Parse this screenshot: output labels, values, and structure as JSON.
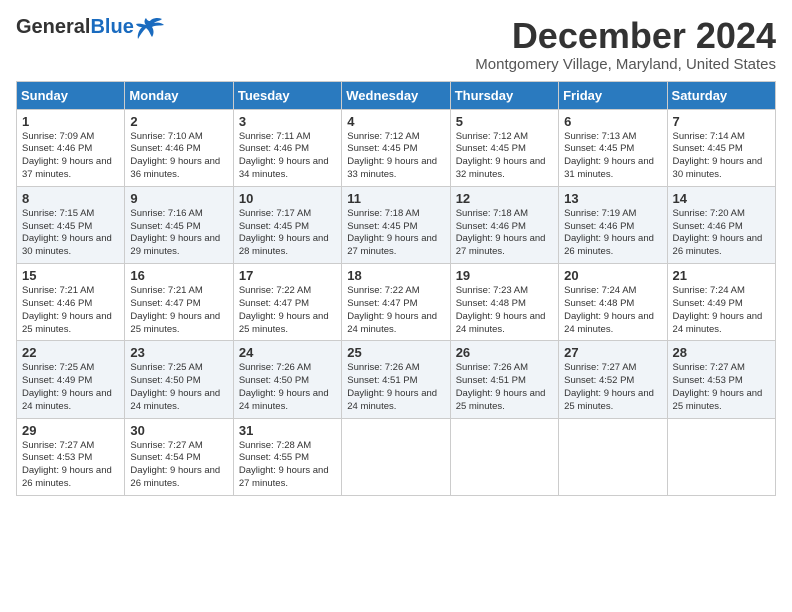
{
  "logo": {
    "general": "General",
    "blue": "Blue"
  },
  "calendar": {
    "title": "December 2024",
    "subtitle": "Montgomery Village, Maryland, United States",
    "headers": [
      "Sunday",
      "Monday",
      "Tuesday",
      "Wednesday",
      "Thursday",
      "Friday",
      "Saturday"
    ],
    "weeks": [
      [
        {
          "day": 1,
          "sunrise": "7:09 AM",
          "sunset": "4:46 PM",
          "daylight": "9 hours and 37 minutes."
        },
        {
          "day": 2,
          "sunrise": "7:10 AM",
          "sunset": "4:46 PM",
          "daylight": "9 hours and 36 minutes."
        },
        {
          "day": 3,
          "sunrise": "7:11 AM",
          "sunset": "4:46 PM",
          "daylight": "9 hours and 34 minutes."
        },
        {
          "day": 4,
          "sunrise": "7:12 AM",
          "sunset": "4:45 PM",
          "daylight": "9 hours and 33 minutes."
        },
        {
          "day": 5,
          "sunrise": "7:12 AM",
          "sunset": "4:45 PM",
          "daylight": "9 hours and 32 minutes."
        },
        {
          "day": 6,
          "sunrise": "7:13 AM",
          "sunset": "4:45 PM",
          "daylight": "9 hours and 31 minutes."
        },
        {
          "day": 7,
          "sunrise": "7:14 AM",
          "sunset": "4:45 PM",
          "daylight": "9 hours and 30 minutes."
        }
      ],
      [
        {
          "day": 8,
          "sunrise": "7:15 AM",
          "sunset": "4:45 PM",
          "daylight": "9 hours and 30 minutes."
        },
        {
          "day": 9,
          "sunrise": "7:16 AM",
          "sunset": "4:45 PM",
          "daylight": "9 hours and 29 minutes."
        },
        {
          "day": 10,
          "sunrise": "7:17 AM",
          "sunset": "4:45 PM",
          "daylight": "9 hours and 28 minutes."
        },
        {
          "day": 11,
          "sunrise": "7:18 AM",
          "sunset": "4:45 PM",
          "daylight": "9 hours and 27 minutes."
        },
        {
          "day": 12,
          "sunrise": "7:18 AM",
          "sunset": "4:46 PM",
          "daylight": "9 hours and 27 minutes."
        },
        {
          "day": 13,
          "sunrise": "7:19 AM",
          "sunset": "4:46 PM",
          "daylight": "9 hours and 26 minutes."
        },
        {
          "day": 14,
          "sunrise": "7:20 AM",
          "sunset": "4:46 PM",
          "daylight": "9 hours and 26 minutes."
        }
      ],
      [
        {
          "day": 15,
          "sunrise": "7:21 AM",
          "sunset": "4:46 PM",
          "daylight": "9 hours and 25 minutes."
        },
        {
          "day": 16,
          "sunrise": "7:21 AM",
          "sunset": "4:47 PM",
          "daylight": "9 hours and 25 minutes."
        },
        {
          "day": 17,
          "sunrise": "7:22 AM",
          "sunset": "4:47 PM",
          "daylight": "9 hours and 25 minutes."
        },
        {
          "day": 18,
          "sunrise": "7:22 AM",
          "sunset": "4:47 PM",
          "daylight": "9 hours and 24 minutes."
        },
        {
          "day": 19,
          "sunrise": "7:23 AM",
          "sunset": "4:48 PM",
          "daylight": "9 hours and 24 minutes."
        },
        {
          "day": 20,
          "sunrise": "7:24 AM",
          "sunset": "4:48 PM",
          "daylight": "9 hours and 24 minutes."
        },
        {
          "day": 21,
          "sunrise": "7:24 AM",
          "sunset": "4:49 PM",
          "daylight": "9 hours and 24 minutes."
        }
      ],
      [
        {
          "day": 22,
          "sunrise": "7:25 AM",
          "sunset": "4:49 PM",
          "daylight": "9 hours and 24 minutes."
        },
        {
          "day": 23,
          "sunrise": "7:25 AM",
          "sunset": "4:50 PM",
          "daylight": "9 hours and 24 minutes."
        },
        {
          "day": 24,
          "sunrise": "7:26 AM",
          "sunset": "4:50 PM",
          "daylight": "9 hours and 24 minutes."
        },
        {
          "day": 25,
          "sunrise": "7:26 AM",
          "sunset": "4:51 PM",
          "daylight": "9 hours and 24 minutes."
        },
        {
          "day": 26,
          "sunrise": "7:26 AM",
          "sunset": "4:51 PM",
          "daylight": "9 hours and 25 minutes."
        },
        {
          "day": 27,
          "sunrise": "7:27 AM",
          "sunset": "4:52 PM",
          "daylight": "9 hours and 25 minutes."
        },
        {
          "day": 28,
          "sunrise": "7:27 AM",
          "sunset": "4:53 PM",
          "daylight": "9 hours and 25 minutes."
        }
      ],
      [
        {
          "day": 29,
          "sunrise": "7:27 AM",
          "sunset": "4:53 PM",
          "daylight": "9 hours and 26 minutes."
        },
        {
          "day": 30,
          "sunrise": "7:27 AM",
          "sunset": "4:54 PM",
          "daylight": "9 hours and 26 minutes."
        },
        {
          "day": 31,
          "sunrise": "7:28 AM",
          "sunset": "4:55 PM",
          "daylight": "9 hours and 27 minutes."
        },
        null,
        null,
        null,
        null
      ]
    ]
  }
}
